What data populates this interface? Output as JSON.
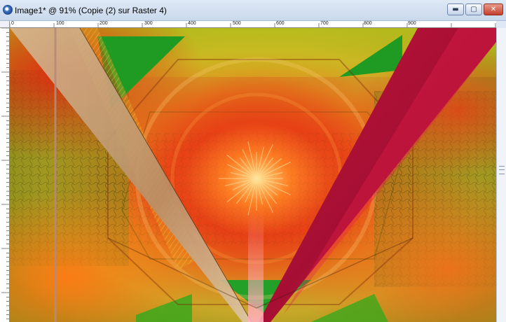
{
  "window": {
    "title": "Image1* @  91% (Copie (2) sur Raster 4)",
    "buttons": {
      "minimize": "▬",
      "maximize": "▢",
      "close": "✕"
    }
  },
  "ruler": {
    "top_labels": [
      "0",
      "100",
      "200",
      "300",
      "400",
      "500",
      "600",
      "700",
      "800",
      "900"
    ]
  },
  "colors": {
    "titlebar": "#d4e1f2",
    "canvas_base": "#d9421a",
    "crimson_beam": "#b01238",
    "tan_beam": "#c4a27a"
  }
}
